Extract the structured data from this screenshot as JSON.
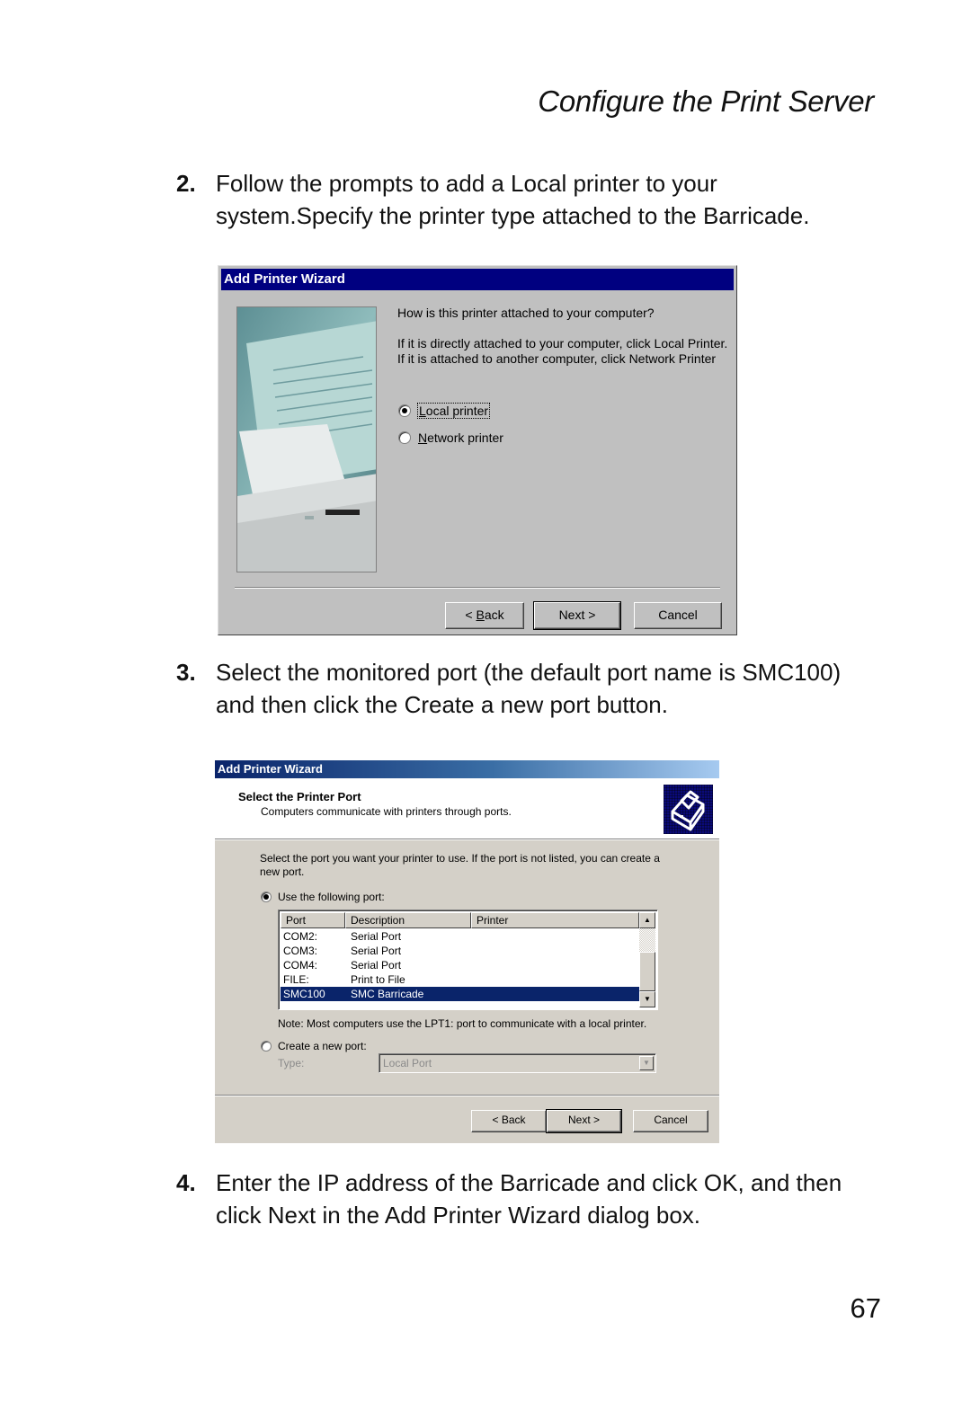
{
  "running_head": "Configure the Print Server",
  "steps": [
    {
      "number": "2.",
      "text": "Follow the prompts to add a Local printer to your system.Specify the printer type attached to the Barricade."
    },
    {
      "number": "3.",
      "text": "Select the monitored port (the default port name is SMC100) and then click the Create a new port button."
    },
    {
      "number": "4.",
      "text": "Enter the IP address of the Barricade and click OK, and then click Next in the Add Printer Wizard dialog box."
    }
  ],
  "page_number": "67",
  "dialog1": {
    "title": "Add Printer Wizard",
    "side_image": "printer-photo",
    "question": "How is this printer attached to your computer?",
    "description": "If it is directly attached to your computer, click Local Printer. If it is attached to another computer, click Network Printer",
    "options": [
      {
        "label": "Local printer",
        "accel": "L",
        "rest": "ocal printer",
        "checked": true
      },
      {
        "label": "Network printer",
        "accel": "N",
        "rest": "etwork printer",
        "checked": false
      }
    ],
    "buttons": {
      "back_prefix": "< ",
      "back_accel": "B",
      "back_rest": "ack",
      "next": "Next >",
      "cancel": "Cancel"
    },
    "colors": {
      "titlebar": "#000080",
      "face": "#c0c0c0"
    }
  },
  "dialog2": {
    "title": "Add Printer Wizard",
    "header_title": "Select the Printer Port",
    "header_subtitle": "Computers communicate with printers through ports.",
    "header_icon": "printer-icon",
    "intro": "Select the port you want your printer to use.  If the port is not listed, you can create a new port.",
    "use_port_label": "Use the following port:",
    "use_port_checked": true,
    "table": {
      "columns": [
        "Port",
        "Description",
        "Printer"
      ],
      "rows": [
        {
          "port": "COM2:",
          "description": "Serial Port",
          "printer": "",
          "selected": false
        },
        {
          "port": "COM3:",
          "description": "Serial Port",
          "printer": "",
          "selected": false
        },
        {
          "port": "COM4:",
          "description": "Serial Port",
          "printer": "",
          "selected": false
        },
        {
          "port": "FILE:",
          "description": "Print to File",
          "printer": "",
          "selected": false
        },
        {
          "port": "SMC100",
          "description": "SMC Barricade",
          "printer": "",
          "selected": true
        }
      ]
    },
    "note": "Note: Most computers use the LPT1: port to communicate with a local printer.",
    "create_port_label": "Create a new port:",
    "create_port_checked": false,
    "type_label": "Type:",
    "type_value": "Local Port",
    "buttons": {
      "back": "< Back",
      "next": "Next >",
      "cancel": "Cancel"
    },
    "colors": {
      "selection": "#0a246a",
      "face": "#d4d0c8",
      "title_start": "#0a246a",
      "title_end": "#a6caf0"
    }
  }
}
